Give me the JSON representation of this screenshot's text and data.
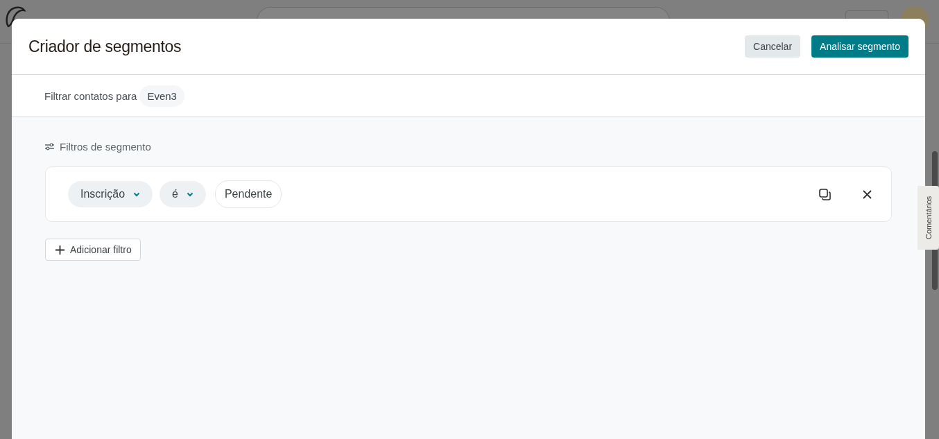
{
  "modal": {
    "title": "Criador de segmentos",
    "buttons": [
      {
        "label": "Cancelar",
        "kind": "secondary"
      },
      {
        "label": "Analisar segmento",
        "kind": "primary"
      }
    ]
  },
  "audience": {
    "label": "Filtrar contatos para",
    "value": "Even3"
  },
  "filters": {
    "heading": "Filtros de segmento",
    "rows": [
      {
        "field": "Inscrição",
        "operator": "é",
        "value": "Pendente"
      }
    ],
    "add_button": "Adicionar filtro"
  },
  "side_tab": {
    "label": "Comentários"
  }
}
